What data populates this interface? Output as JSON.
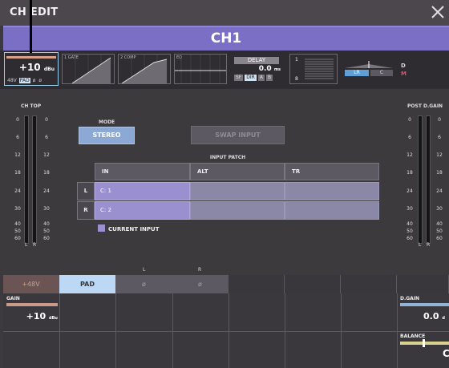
{
  "window": {
    "title": "CH EDIT",
    "close_icon": "close-icon"
  },
  "channel": {
    "name": "CH1",
    "bar_color": "#7a6fc4"
  },
  "strip": {
    "gain_value": "+10",
    "gain_unit": "dBu",
    "flags": [
      "48V",
      "PAD",
      "ø",
      "ø"
    ],
    "flag_active": "PAD",
    "gate_label": "1 GATE",
    "comp_label": "2 COMP",
    "eq_label": "EQ",
    "delay": {
      "label": "DELAY",
      "value": "0.0",
      "unit": "ms",
      "buttons": [
        "SF",
        "DIR",
        "A",
        "B"
      ],
      "active": "DIR"
    },
    "route": {
      "top": "1",
      "bottom": "8"
    },
    "pan": {
      "lr": "LR",
      "c": "C"
    },
    "dm": {
      "d": "D",
      "m": "M"
    }
  },
  "meters": {
    "left_title": "CH TOP",
    "right_title": "POST D.GAIN",
    "scale": [
      "0",
      "6",
      "12",
      "18",
      "24",
      "30",
      "40",
      "50",
      "60"
    ],
    "l": "L",
    "r": "R"
  },
  "mode": {
    "label": "MODE",
    "stereo": "STEREO",
    "swap": "SWAP INPUT"
  },
  "patch": {
    "title": "INPUT PATCH",
    "headers": [
      "IN",
      "ALT",
      "TR"
    ],
    "rows": [
      {
        "label": "L",
        "in": "C: 1",
        "alt": "",
        "tr": ""
      },
      {
        "label": "R",
        "in": "C: 2",
        "alt": "",
        "tr": ""
      }
    ],
    "legend": "CURRENT INPUT",
    "current_color": "#9a8fcf"
  },
  "bottom": {
    "phase_l": "L",
    "phase_r": "R",
    "btn_48v": "+48V",
    "btn_pad": "PAD",
    "phase_symbol": "ø",
    "gain_label": "GAIN",
    "gain_value": "+10",
    "gain_unit": "dBu",
    "dgain_label": "D.GAIN",
    "dgain_value": "0.0",
    "dgain_unit": "d",
    "balance_label": "BALANCE",
    "balance_value": "C"
  }
}
